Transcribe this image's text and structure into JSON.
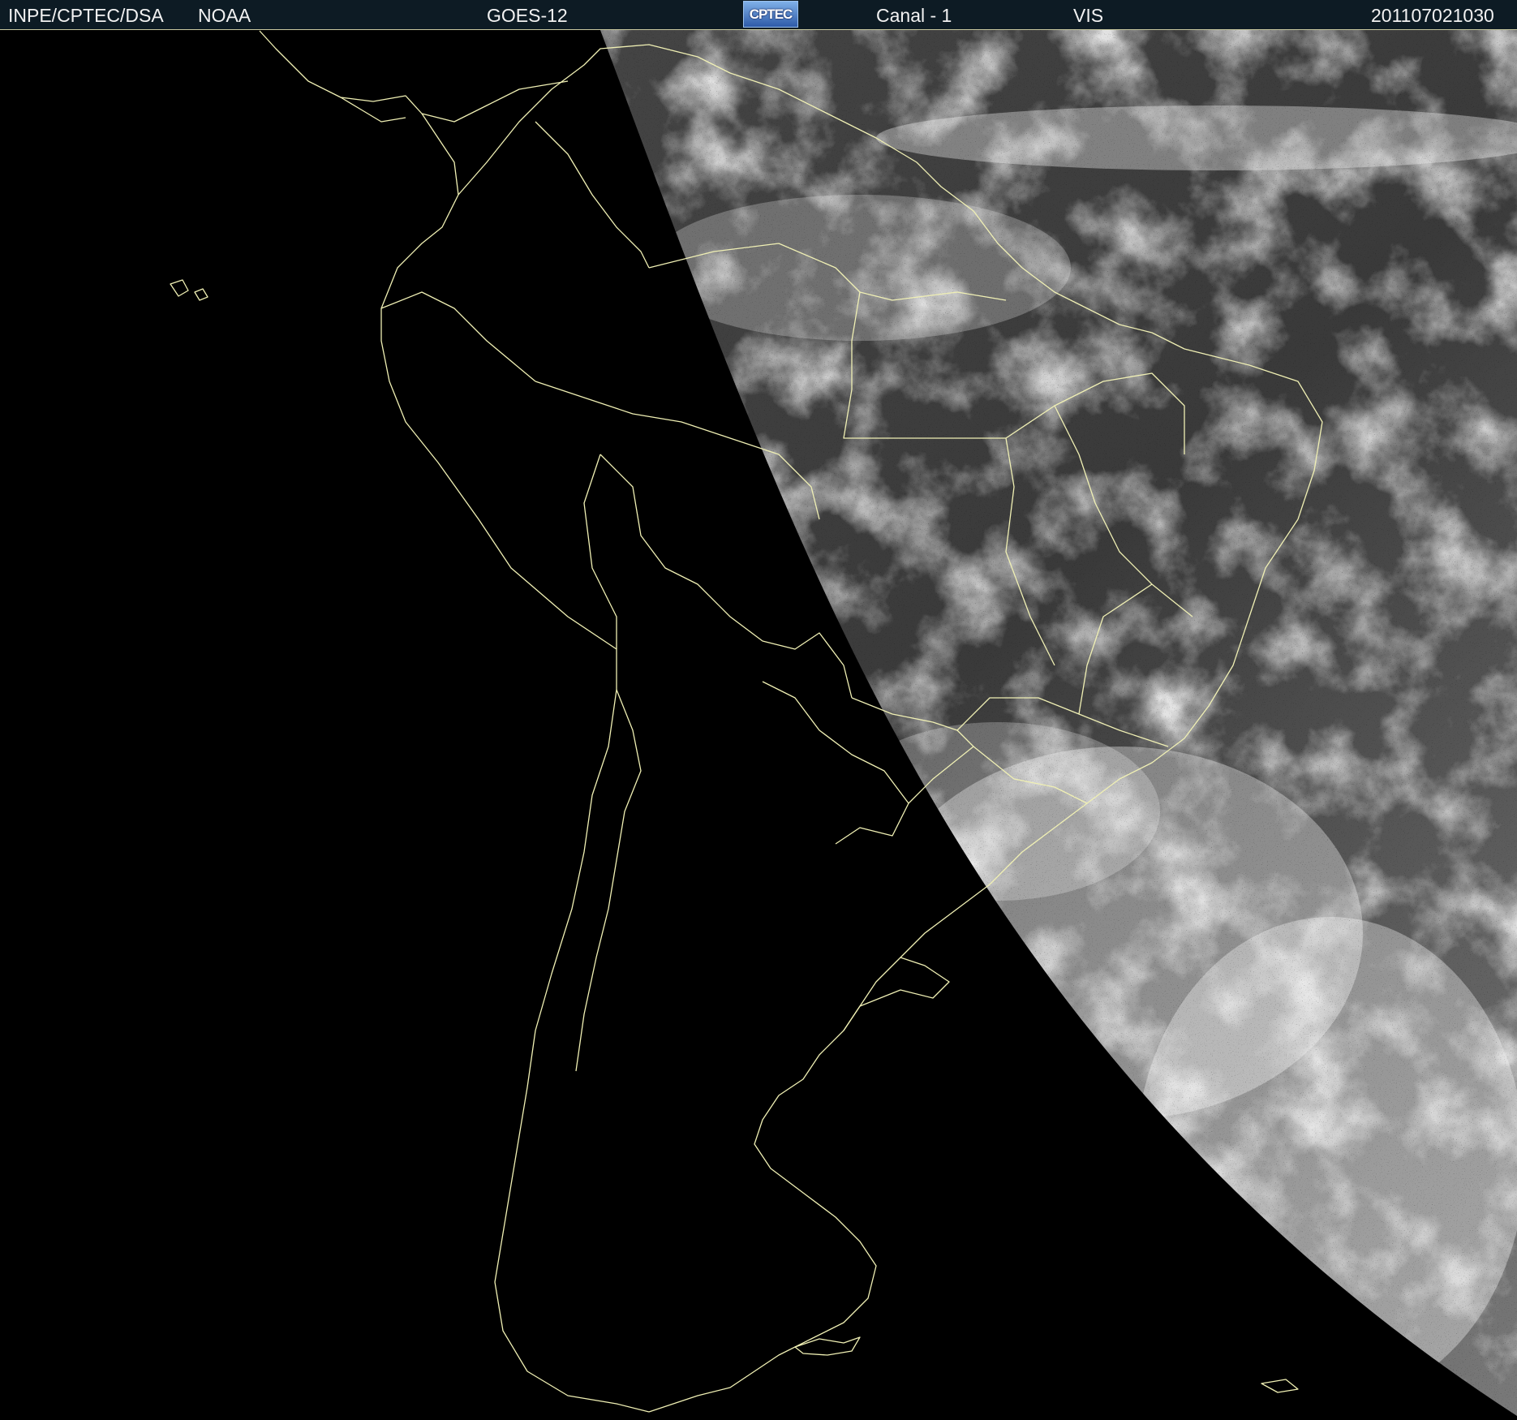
{
  "header": {
    "institution": "INPE/CPTEC/DSA",
    "agency": "NOAA",
    "satellite": "GOES-12",
    "logo_text": "CPTEC",
    "channel": "Canal - 1",
    "band": "VIS",
    "timestamp": "201107021030"
  },
  "colors": {
    "header_bg": "#0d1b24",
    "space_bg": "#000000",
    "border_lines": "#f0f0b4",
    "cloud_bright": "#e6e6e6",
    "ocean_day": "#3c3c3c"
  },
  "map": {
    "projection": "satellite",
    "illumination": "day/night terminator; day side east",
    "overlay": "country and state borders"
  }
}
